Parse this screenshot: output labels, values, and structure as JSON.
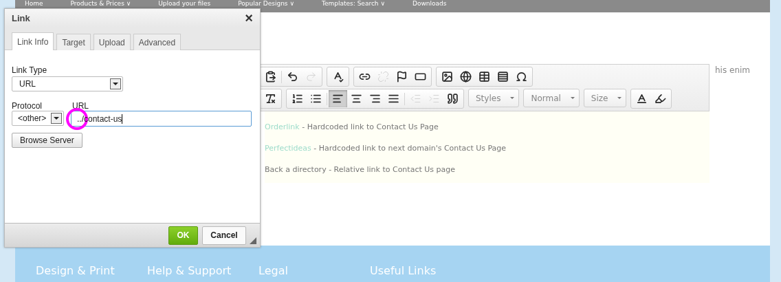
{
  "nav": [
    "Home",
    "Products & Prices ∨",
    "Upload your files",
    "Popular Designs ∨",
    "Templates: Search ∨",
    "Downloads"
  ],
  "side_text": "his enim",
  "toolbar": {
    "rows": [
      [
        {
          "sections": [
            [
              {
                "kind": "paste",
                "disabled": false
              }
            ],
            [
              {
                "kind": "undo",
                "disabled": false
              },
              {
                "kind": "redo",
                "disabled": true
              }
            ]
          ]
        },
        {
          "sections": [
            [
              {
                "kind": "spellcheck",
                "disabled": false
              }
            ]
          ]
        },
        {
          "sections": [
            [
              {
                "kind": "link",
                "disabled": false
              },
              {
                "kind": "unlink",
                "disabled": true
              },
              {
                "kind": "anchor",
                "disabled": false
              },
              {
                "kind": "iframe",
                "disabled": false
              }
            ]
          ]
        },
        {
          "sections": [
            [
              {
                "kind": "image",
                "disabled": false
              },
              {
                "kind": "globe",
                "disabled": false
              },
              {
                "kind": "table",
                "disabled": false
              },
              {
                "kind": "rule",
                "disabled": false
              },
              {
                "kind": "omega",
                "disabled": false
              }
            ]
          ]
        }
      ],
      [
        {
          "sections": [
            [
              {
                "kind": "clearformat",
                "disabled": false
              }
            ]
          ]
        },
        {
          "sections": [
            [
              {
                "kind": "numbered",
                "disabled": false
              },
              {
                "kind": "bulleted",
                "disabled": false
              }
            ],
            [
              {
                "kind": "alignleft",
                "disabled": false,
                "selected": true
              },
              {
                "kind": "aligncenter",
                "disabled": false,
                "selected": false
              },
              {
                "kind": "alignright",
                "disabled": false,
                "selected": false
              },
              {
                "kind": "justify",
                "disabled": false,
                "selected": false
              }
            ],
            [
              {
                "kind": "outdent",
                "disabled": true
              },
              {
                "kind": "indent",
                "disabled": true
              },
              {
                "kind": "quote",
                "disabled": false
              }
            ]
          ]
        },
        {
          "combo": "Styles"
        },
        {
          "combo": "Normal"
        },
        {
          "combo": "Size"
        },
        {
          "sections": [
            [
              {
                "kind": "textcolor",
                "disabled": false
              },
              {
                "kind": "bgcolor",
                "disabled": false
              }
            ]
          ]
        }
      ]
    ]
  },
  "content": [
    {
      "link": "Orderlink",
      "text": "- Hardcoded link to Contact Us Page"
    },
    {
      "link": "Perfectideas",
      "text": "- Hardcoded link to next domain's Contact Us Page"
    },
    {
      "text": "Back a directory - Relative link to Contact Us page"
    }
  ],
  "footer": [
    "Design & Print",
    "Help & Support",
    "Legal",
    "Useful Links"
  ],
  "dialog": {
    "title": "Link",
    "close": "×",
    "tabs": [
      {
        "label": "Link Info",
        "selected": true
      },
      {
        "label": "Target",
        "selected": false
      },
      {
        "label": "Upload",
        "selected": false
      },
      {
        "label": "Advanced",
        "selected": false
      }
    ],
    "link_type": {
      "label": "Link Type",
      "value": "URL"
    },
    "protocol": {
      "label": "Protocol",
      "value": "<other>"
    },
    "url": {
      "label": "URL",
      "value": "../contact-us"
    },
    "browse": "Browse Server",
    "ok": "OK",
    "cancel": "Cancel"
  }
}
